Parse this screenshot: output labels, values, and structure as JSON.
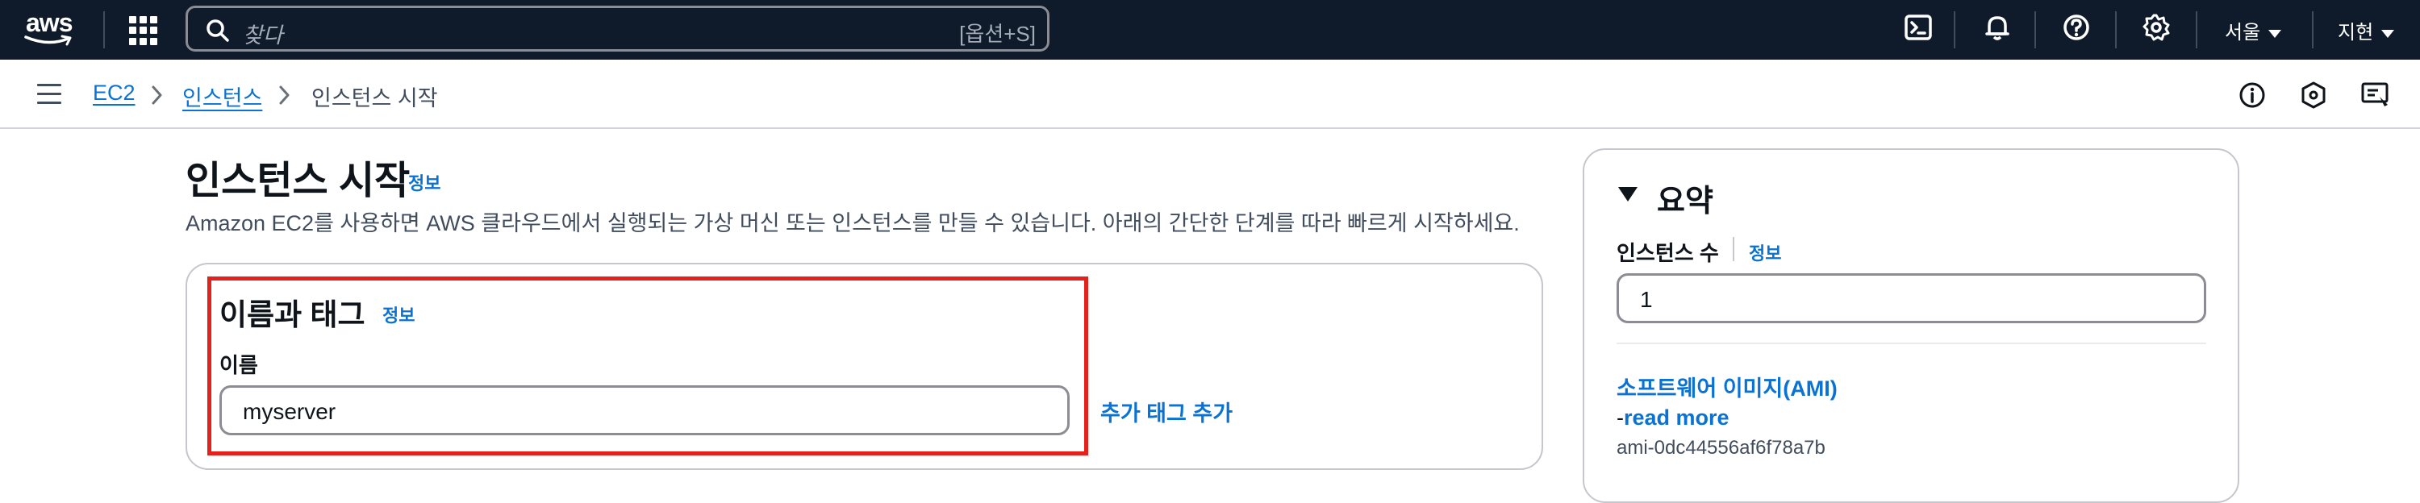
{
  "topbar": {
    "logo_text": "aws",
    "search_placeholder": "찾다",
    "search_shortcut": "[옵션+S]",
    "icons": [
      "cloudshell-icon",
      "bell-icon",
      "help-icon",
      "gear-icon"
    ],
    "region_label": "서울",
    "user_label": "지현"
  },
  "breadcrumb": {
    "items": [
      "EC2",
      "인스턴스",
      "인스턴스 시작"
    ]
  },
  "page": {
    "title": "인스턴스 시작",
    "info_label": "정보",
    "description": "Amazon EC2를 사용하면 AWS 클라우드에서 실행되는 가상 머신 또는 인스턴스를 만들 수 있습니다. 아래의 간단한 단계를 따라 빠르게 시작하세요."
  },
  "name_tags": {
    "heading": "이름과 태그",
    "info_label": "정보",
    "name_label": "이름",
    "name_value": "myserver",
    "add_tag_label": "추가 태그 추가"
  },
  "summary": {
    "heading": "요약",
    "count_label": "인스턴스 수",
    "info_label": "정보",
    "count_value": "1",
    "ami_link": "소프트웨어 이미지(AMI)",
    "read_more_prefix": "-",
    "read_more": "read more",
    "ami_id": "ami-0dc44556af6f78a7b"
  },
  "colors": {
    "topbar_bg": "#0f1b2a",
    "link": "#0972d3",
    "highlight_border": "#e4211b"
  }
}
